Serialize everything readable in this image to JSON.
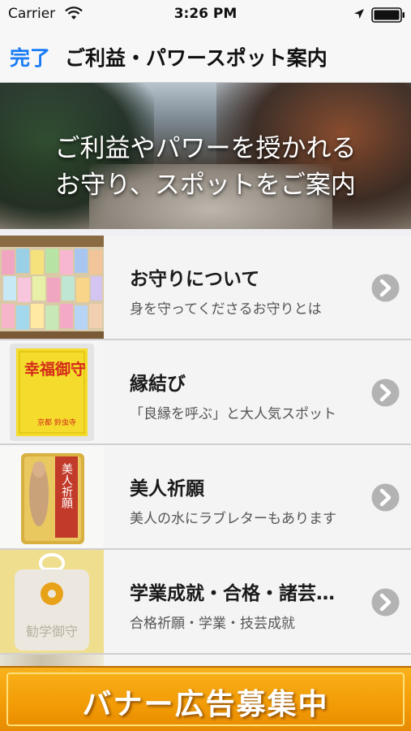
{
  "status_bar": {
    "carrier": "Carrier",
    "time": "3:26 PM"
  },
  "nav": {
    "done_label": "完了",
    "title": "ご利益・パワースポット案内"
  },
  "hero": {
    "line1": "ご利益やパワーを授かれる",
    "line2": "お守り、スポットをご案内"
  },
  "items": [
    {
      "title": "お守りについて",
      "subtitle": "身を守ってくださるお守りとは",
      "thumbnail_icon": "omamori-rack-photo"
    },
    {
      "title": "縁結び",
      "subtitle": "「良縁を呼ぶ」と大人気スポット",
      "thumbnail_icon": "kofuku-omamori-photo",
      "thumbnail_text": "幸福御守"
    },
    {
      "title": "美人祈願",
      "subtitle": "美人の水にラブレターもあります",
      "thumbnail_icon": "bijin-omamori-photo",
      "thumbnail_text": "美人祈願"
    },
    {
      "title": "学業成就・合格・諸芸…",
      "subtitle": "合格祈願・学業・技芸成就",
      "thumbnail_icon": "gakugyo-omamori-photo",
      "thumbnail_text": "勧学御守"
    }
  ],
  "ad": {
    "label": "バナー広告募集中"
  },
  "colors": {
    "accent": "#1a7cf5",
    "ad_orange": "#f29b06",
    "chevron": "#b3b3b3"
  }
}
